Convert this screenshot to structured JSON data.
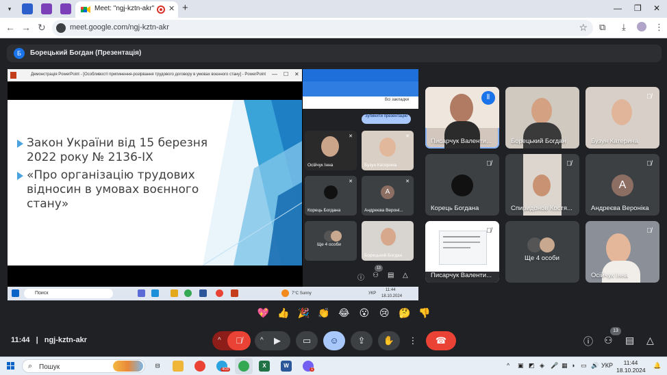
{
  "browser": {
    "active_tab_title": "Meet: \"ngj-kztn-akr\"",
    "url": "meet.google.com/ngj-kztn-akr",
    "icons": [
      "chevron-down-icon",
      "tab-icon",
      "tab-icon",
      "tab-icon",
      "meet-icon",
      "record-icon",
      "close-icon",
      "plus-icon",
      "minimize-icon",
      "maximize-icon",
      "close-icon",
      "back-icon",
      "forward-icon",
      "reload-icon",
      "star-icon",
      "extensions-icon",
      "download-icon",
      "profile-icon",
      "menu-icon"
    ]
  },
  "presenter": {
    "initial": "Б",
    "name": "Борецький Богдан (Презентація)"
  },
  "shared_screen": {
    "ppt_window_title": "Демонстрація PowerPoint - [Особливості припинення-розірвання трудового договору в умовах воєнного стану] - PowerPoint",
    "slide_bullets": [
      [
        "Закон України від 15 березня",
        "2022 року № 2136-IX"
      ],
      [
        "«Про організацію трудових",
        "відносин в умовах воєнного",
        "стану»"
      ]
    ],
    "bookmarks_label": "Всі закладки",
    "stop_presenting": "Зупинити презентацію",
    "mini_tiles": [
      {
        "name": "Осійчук Інна"
      },
      {
        "name": "Бузун Катерина"
      },
      {
        "name": "Корець Богдана"
      },
      {
        "name": "Андреєва Вероні...",
        "initial": "А"
      },
      {
        "name": "Ще 4 особи"
      },
      {
        "name": "Борецький Богдан"
      }
    ],
    "mini_participants_count": "13",
    "taskbar": {
      "search_placeholder": "Поиск",
      "weather": "7°C  Sunny",
      "lang": "УКР",
      "time": "11:44",
      "date": "18.10.2024"
    }
  },
  "participants": [
    {
      "name": "Писарчук Валенти...",
      "speaking": true
    },
    {
      "name": "Борецький Богдан",
      "muted": false
    },
    {
      "name": "Бузун Катерина",
      "muted": true
    },
    {
      "name": "Корець Богдана",
      "muted": true
    },
    {
      "name": "Спиридонов Костя...",
      "muted": true
    },
    {
      "name": "Андреєва Вероніка",
      "muted": true,
      "initial": "А",
      "avatar_color": "#8d6e63"
    },
    {
      "name": "Писарчук Валенти...",
      "muted": true
    },
    {
      "name": "Ще 4 особи"
    },
    {
      "name": "Осійчук Інна",
      "muted": true
    }
  ],
  "reactions": [
    "💖",
    "👍",
    "🎉",
    "👏",
    "😂",
    "😮",
    "😢",
    "🤔",
    "👎"
  ],
  "bottom_bar": {
    "time": "11:44",
    "separator": "|",
    "meeting_code": "ngj-kztn-akr",
    "participants_count": "13",
    "icons": [
      "chevron-up-icon",
      "mic-off-icon",
      "chevron-up-icon",
      "camera-icon",
      "captions-icon",
      "emoji-icon",
      "present-icon",
      "raise-hand-icon",
      "more-icon",
      "hang-up-icon",
      "info-icon",
      "people-icon",
      "chat-icon",
      "activities-icon"
    ]
  },
  "taskbar": {
    "search_placeholder": "Пошук",
    "lang": "УКР",
    "time": "11:44",
    "date": "18.10.2024",
    "telegram_badge": "403",
    "viber_badge": "1"
  }
}
